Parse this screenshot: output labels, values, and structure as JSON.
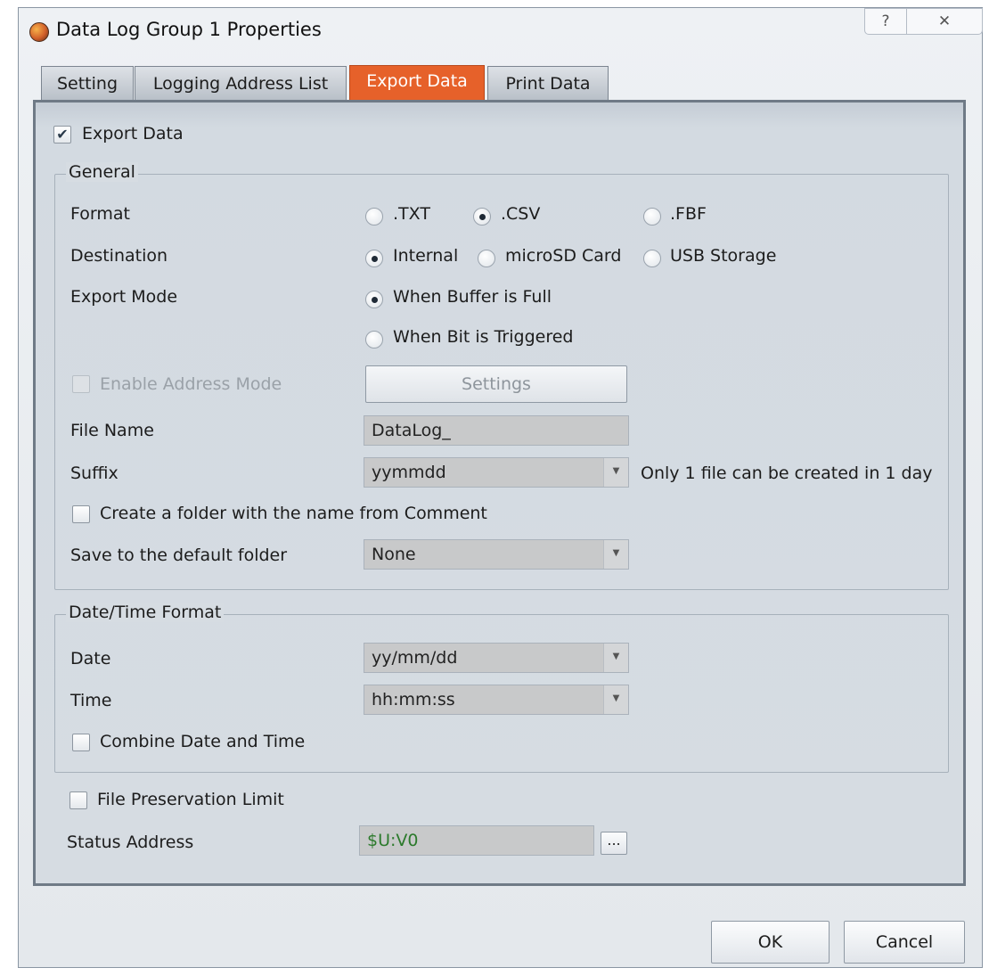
{
  "window": {
    "title": "Data Log Group 1 Properties",
    "help_glyph": "?",
    "close_glyph": "✕"
  },
  "tabs": [
    {
      "label": "Setting",
      "active": false
    },
    {
      "label": "Logging Address List",
      "active": false
    },
    {
      "label": "Export Data",
      "active": true
    },
    {
      "label": "Print Data",
      "active": false
    }
  ],
  "export_data": {
    "label": "Export Data",
    "checked": true
  },
  "general": {
    "title": "General",
    "format": {
      "label": "Format",
      "options": [
        ".TXT",
        ".CSV",
        ".FBF"
      ],
      "selected": ".CSV"
    },
    "destination": {
      "label": "Destination",
      "options": [
        "Internal",
        "microSD Card",
        "USB Storage"
      ],
      "selected": "Internal"
    },
    "export_mode": {
      "label": "Export Mode",
      "options": [
        "When Buffer is Full",
        "When Bit is Triggered"
      ],
      "selected": "When Buffer is Full"
    },
    "enable_address_mode": {
      "label": "Enable Address Mode",
      "checked": false,
      "disabled": true
    },
    "settings_button": "Settings",
    "file_name": {
      "label": "File Name",
      "value": "DataLog_"
    },
    "suffix": {
      "label": "Suffix",
      "value": "yymmdd",
      "note": "Only 1 file can be created in 1 day"
    },
    "create_folder": {
      "label": "Create a folder with the name from Comment",
      "checked": false
    },
    "default_folder": {
      "label": "Save to the default folder",
      "value": "None"
    }
  },
  "datetime": {
    "title": "Date/Time Format",
    "date": {
      "label": "Date",
      "value": "yy/mm/dd"
    },
    "time": {
      "label": "Time",
      "value": "hh:mm:ss"
    },
    "combine": {
      "label": "Combine Date and Time",
      "checked": false
    }
  },
  "file_preservation_limit": {
    "label": "File Preservation Limit",
    "checked": false
  },
  "status_address": {
    "label": "Status Address",
    "value": "$U:V0",
    "browse_label": "..."
  },
  "buttons": {
    "ok": "OK",
    "cancel": "Cancel"
  },
  "colors": {
    "active_tab": "#e6612a",
    "status_value": "#2c7a2c"
  },
  "icons": {
    "dropdown": "chevron-down-icon",
    "checkmark": "checkmark-icon"
  }
}
